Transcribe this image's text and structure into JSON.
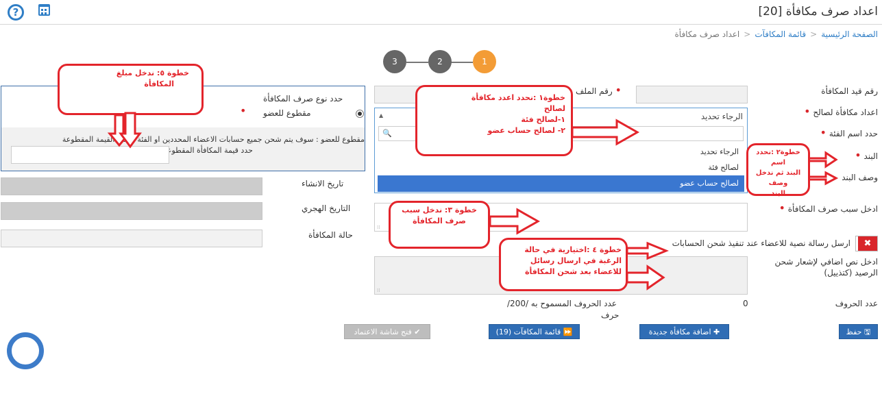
{
  "header": {
    "title": "اعداد صرف مكافأة [20]",
    "help_icon": "question-circle-icon",
    "calendar_icon": "calendar-icon"
  },
  "breadcrumb": {
    "home": "الصفحة الرئيسية",
    "list": "قائمة المكافآت",
    "current": "اعداد صرف مكافأة"
  },
  "wizard": {
    "steps": [
      "1",
      "2",
      "3"
    ],
    "active_color": "#f39c36",
    "inactive_color": "#666666"
  },
  "form": {
    "reward_no_label": "رقم قيد المكافأة",
    "file_no_label": "رقم الملف",
    "prepare_for_label": "اعداد مكافأة لصالح",
    "select_placeholder": "الرجاء تحديد",
    "dropdown_options": [
      "الرجاء تحديد",
      "لصالح فئة",
      "لصالح حساب عضو"
    ],
    "category_name_label": "حدد اسم الفئة",
    "item_label": "البند",
    "item_desc_label": "وصف البند",
    "reason_label": "ادخل سبب صرف المكافأة",
    "sms_label": "ارسل رسالة نصية للاعضاء عند تنفيذ شحن الحسابات",
    "extra_text_label": "ادخل نص اضافي لإشعار شحن الرصيد (كتذييل)",
    "char_count_label": "عدد الحروف",
    "char_count_value": "0",
    "allowed_chars_label": "عدد الحروف المسموح به /200/",
    "allowed_chars_unit": "حرف",
    "created_date_label": "تاريخ الانشاء",
    "hijri_date_label": "التاريخ الهجري",
    "status_label": "حالة المكافأة",
    "payment_type_label": "حدد نوع صرف المكافأة",
    "payment_type_option": "مقطوع للعضو",
    "payment_note": "مقطوع للعضو : سوف يتم شحن جميع حسابات الاعضاء المحددين او الفئة بنفس القيمة المقطوعة",
    "amount_label": "حدد قيمة المكافأة المقطوعة للاعضاء"
  },
  "buttons": {
    "save": "حفظ",
    "new": "اضافة مكافأة جديدة",
    "list": "قائمة المكافآت (19)",
    "approval": "فتح شاشة الاعتماد"
  },
  "annotations": {
    "step1": [
      "خطوة١ :نحدد اعدد مكافأة",
      "لصالح",
      "١-لصالح فئة",
      "٢- لصالح حساب عضو"
    ],
    "step2": [
      "خطوة٢ :نحدد اسم",
      "البند ثم ندخل وصف",
      "البند"
    ],
    "step3": [
      "خطوة ٣: ندخل سبب",
      "صرف المكافأة"
    ],
    "step4": [
      "خطوة ٤ :اختيارية في حالة",
      "الرغبة في ارسال رسائل",
      "للاعضاء بعد شحن المكافأة"
    ],
    "step5": [
      "خطوة ٥: ندخل مبلغ",
      "المكافأة"
    ],
    "color": "#e3242b"
  }
}
